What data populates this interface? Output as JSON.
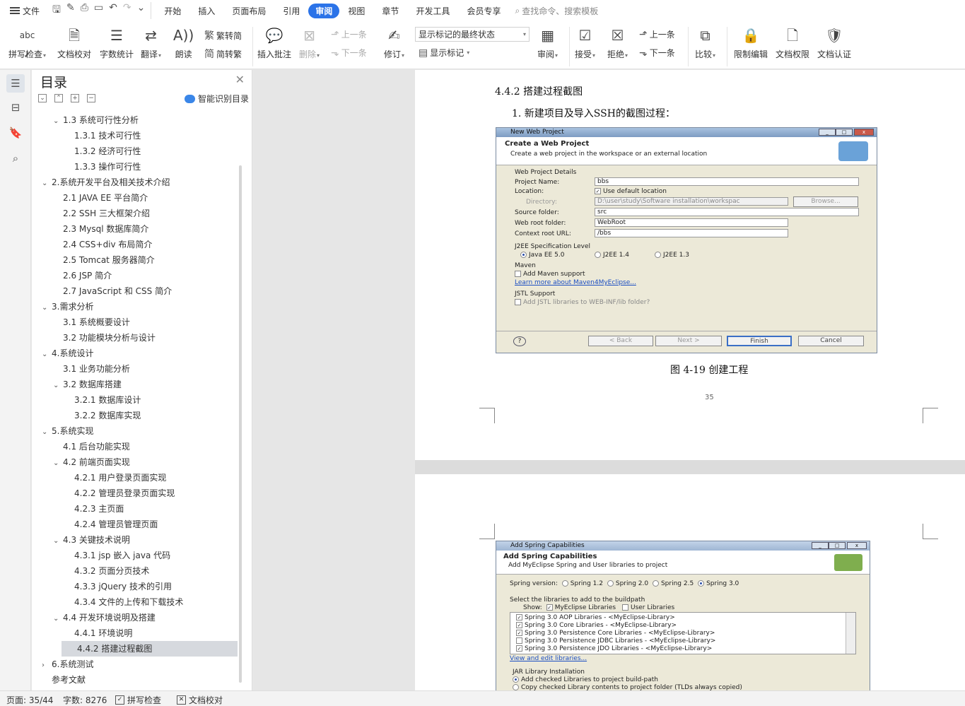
{
  "menubar": {
    "file": "文件",
    "tabs": [
      "开始",
      "插入",
      "页面布局",
      "引用",
      "审阅",
      "视图",
      "章节",
      "开发工具",
      "会员专享"
    ],
    "active_tab": "审阅",
    "search_placeholder": "查找命令、搜索模板"
  },
  "ribbon": {
    "spell": "拼写检查",
    "proofread": "文档校对",
    "wordcount": "字数统计",
    "translate": "翻译",
    "read": "朗读",
    "trad": "繁转简",
    "simp": "简转繁",
    "insert_comment": "插入批注",
    "delete": "删除",
    "prev_comment": "上一条",
    "next_comment": "下一条",
    "revise": "修订",
    "markup_select": "显示标记的最终状态",
    "show_markup": "显示标记",
    "review": "审阅",
    "accept": "接受",
    "reject": "拒绝",
    "prev_change": "上一条",
    "next_change": "下一条",
    "compare": "比较",
    "restrict": "限制编辑",
    "permission": "文档权限",
    "certify": "文档认证"
  },
  "toc": {
    "title": "目录",
    "smart": "智能识别目录",
    "items": [
      {
        "text": "1.3  系统可行性分析",
        "level": 2,
        "caret": "v"
      },
      {
        "text": "1.3.1  技术可行性",
        "level": 3,
        "caret": ""
      },
      {
        "text": "1.3.2  经济可行性",
        "level": 3,
        "caret": ""
      },
      {
        "text": "1.3.3  操作可行性",
        "level": 3,
        "caret": ""
      },
      {
        "text": "2.系统开发平台及相关技术介绍",
        "level": 1,
        "caret": "v"
      },
      {
        "text": "2.1 JAVA EE 平台简介",
        "level": 2,
        "caret": ""
      },
      {
        "text": "2.2 SSH 三大框架介绍",
        "level": 2,
        "caret": ""
      },
      {
        "text": "2.3 Mysql 数据库简介",
        "level": 2,
        "caret": ""
      },
      {
        "text": "2.4 CSS+div 布局简介",
        "level": 2,
        "caret": ""
      },
      {
        "text": "2.5 Tomcat 服务器简介",
        "level": 2,
        "caret": ""
      },
      {
        "text": "2.6 JSP 简介",
        "level": 2,
        "caret": ""
      },
      {
        "text": "2.7 JavaScript 和 CSS 简介",
        "level": 2,
        "caret": ""
      },
      {
        "text": "3.需求分析",
        "level": 1,
        "caret": "v"
      },
      {
        "text": "3.1 系统概要设计",
        "level": 2,
        "caret": ""
      },
      {
        "text": "3.2 功能模块分析与设计",
        "level": 2,
        "caret": ""
      },
      {
        "text": "4.系统设计",
        "level": 1,
        "caret": "v"
      },
      {
        "text": "3.1 业务功能分析",
        "level": 2,
        "caret": ""
      },
      {
        "text": "3.2 数据库搭建",
        "level": 2,
        "caret": "v"
      },
      {
        "text": "3.2.1 数据库设计",
        "level": 3,
        "caret": ""
      },
      {
        "text": "3.2.2 数据库实现",
        "level": 3,
        "caret": ""
      },
      {
        "text": "5.系统实现",
        "level": 1,
        "caret": "v"
      },
      {
        "text": "4.1 后台功能实现",
        "level": 2,
        "caret": ""
      },
      {
        "text": "4.2 前端页面实现",
        "level": 2,
        "caret": "v"
      },
      {
        "text": "4.2.1 用户登录页面实现",
        "level": 3,
        "caret": ""
      },
      {
        "text": "4.2.2 管理员登录页面实现",
        "level": 3,
        "caret": ""
      },
      {
        "text": "4.2.3 主页面",
        "level": 3,
        "caret": ""
      },
      {
        "text": "4.2.4 管理员管理页面",
        "level": 3,
        "caret": ""
      },
      {
        "text": "4.3  关键技术说明",
        "level": 2,
        "caret": "v"
      },
      {
        "text": "4.3.1 jsp 嵌入 java 代码",
        "level": 3,
        "caret": ""
      },
      {
        "text": "4.3.2 页面分页技术",
        "level": 3,
        "caret": ""
      },
      {
        "text": "4.3.3 jQuery 技术的引用",
        "level": 3,
        "caret": ""
      },
      {
        "text": "4.3.4 文件的上传和下载技术",
        "level": 3,
        "caret": ""
      },
      {
        "text": "4.4 开发环境说明及搭建",
        "level": 2,
        "caret": "v"
      },
      {
        "text": "4.4.1 环境说明",
        "level": 3,
        "caret": ""
      },
      {
        "text": "4.4.2 搭建过程截图",
        "level": 3,
        "caret": "",
        "selected": true
      },
      {
        "text": "6.系统测试",
        "level": 1,
        "caret": ">"
      },
      {
        "text": "参考文献",
        "level": 1,
        "caret": ""
      }
    ]
  },
  "doc": {
    "heading": "4.4.2 搭建过程截图",
    "step": "1.  新建项目及导入SSH的截图过程：",
    "caption": "图 4-19  创建工程",
    "page_number": "35",
    "dialog1": {
      "title": "New Web Project",
      "header": "Create a Web Project",
      "subheader": "Create a web project in the workspace or an external location",
      "group": "Web Project Details",
      "project_name_label": "Project Name:",
      "project_name": "bbs",
      "location_label": "Location:",
      "use_default": "Use default location",
      "directory_label": "Directory:",
      "directory": "D:\\user\\study\\Software installation\\workspac",
      "browse": "Browse...",
      "source_label": "Source folder:",
      "source": "src",
      "webroot_label": "Web root folder:",
      "webroot": "WebRoot",
      "context_label": "Context root URL:",
      "context": "/bbs",
      "j2ee_label": "J2EE Specification Level",
      "j2ee_options": [
        "Java EE 5.0",
        "J2EE 1.4",
        "J2EE 1.3"
      ],
      "maven_label": "Maven",
      "maven_add": "Add Maven support",
      "maven_link": "Learn more about Maven4MyEclipse...",
      "jstl_label": "JSTL Support",
      "jstl_add": "Add JSTL libraries to WEB-INF/lib folder?",
      "back": "< Back",
      "next": "Next >",
      "finish": "Finish",
      "cancel": "Cancel"
    },
    "dialog2": {
      "title": "Add Spring Capabilities",
      "header": "Add Spring Capabilities",
      "subheader": "Add MyEclipse Spring and User libraries to project",
      "version_label": "Spring version:",
      "versions": [
        "Spring 1.2",
        "Spring 2.0",
        "Spring 2.5",
        "Spring 3.0"
      ],
      "select_label": "Select the libraries to add to the buildpath",
      "show_label": "Show:",
      "show_myeclipse": "MyEclipse Libraries",
      "show_user": "User Libraries",
      "libs": [
        "Spring 3.0 AOP Libraries - <MyEclipse-Library>",
        "Spring 3.0 Core Libraries - <MyEclipse-Library>",
        "Spring 3.0 Persistence Core Libraries - <MyEclipse-Library>",
        "Spring 3.0 Persistence JDBC Libraries - <MyEclipse-Library>",
        "Spring 3.0 Persistence JDO Libraries - <MyEclipse-Library>"
      ],
      "view_link": "View and edit libraries...",
      "jar_label": "JAR Library Installation",
      "jar_add": "Add checked Libraries to project build-path",
      "jar_copy": "Copy checked Library contents to project folder (TLDs always copied)"
    }
  },
  "status": {
    "page": "页面: 35/44",
    "words": "字数: 8276",
    "spell": "拼写检查",
    "proof": "文档校对"
  }
}
